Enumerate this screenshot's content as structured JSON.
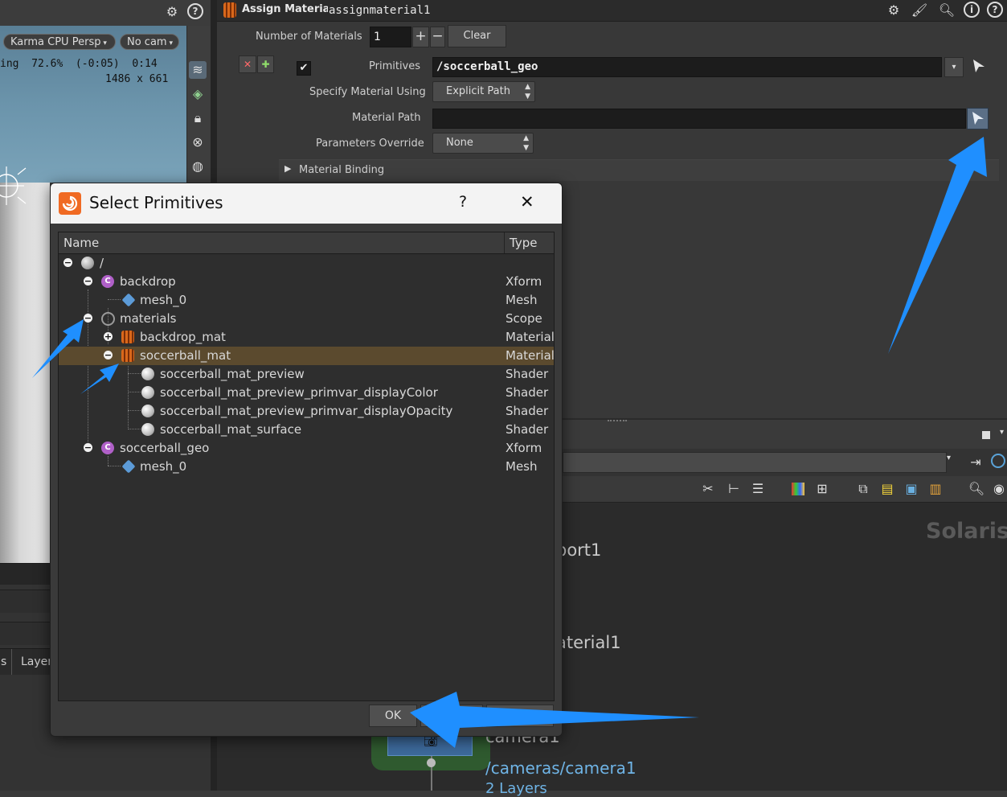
{
  "viewport": {
    "renderer_menu": "Karma CPU",
    "camera_menu": "Persp",
    "cam_menu": "No cam",
    "overlay_line1": "ing  72.6%  (-0:05)  0:14",
    "overlay_line2": "1486 x 661",
    "tab_partial_left": "s",
    "tab_layer": "Layer"
  },
  "params": {
    "node_type": "Assign Material",
    "node_name": "assignmaterial1",
    "num_materials_label": "Number of Materials",
    "num_materials_value": "1",
    "plus_label": "+",
    "minus_label": "−",
    "clear_label": "Clear",
    "primitives_label": "Primitives",
    "primitives_value": "/soccerball_geo",
    "specify_label": "Specify Material Using",
    "specify_value": "Explicit Path",
    "material_path_label": "Material Path",
    "material_path_value": "",
    "override_label": "Parameters Override",
    "override_value": "None",
    "binding_label": "Material Binding"
  },
  "network": {
    "context_label": "Solaris",
    "node_labels": [
      "port1",
      "aterial1",
      "camera1"
    ],
    "camera_path": "/cameras/camera1",
    "layers_partial": "2 Layers"
  },
  "dialog": {
    "title": "Select Primitives",
    "help_label": "?",
    "close_label": "✕",
    "col_name": "Name",
    "col_type": "Type",
    "rows": [
      {
        "name": "/",
        "type": ""
      },
      {
        "name": "backdrop",
        "type": "Xform"
      },
      {
        "name": "mesh_0",
        "type": "Mesh"
      },
      {
        "name": "materials",
        "type": "Scope"
      },
      {
        "name": "backdrop_mat",
        "type": "Material"
      },
      {
        "name": "soccerball_mat",
        "type": "Material"
      },
      {
        "name": "soccerball_mat_preview",
        "type": "Shader"
      },
      {
        "name": "soccerball_mat_preview_primvar_displayColor",
        "type": "Shader"
      },
      {
        "name": "soccerball_mat_preview_primvar_displayOpacity",
        "type": "Shader"
      },
      {
        "name": "soccerball_mat_surface",
        "type": "Shader"
      },
      {
        "name": "soccerball_geo",
        "type": "Xform"
      },
      {
        "name": "mesh_0",
        "type": "Mesh"
      }
    ],
    "ok_label": "OK"
  },
  "colors": {
    "accent_arrow": "#1f8fff",
    "selection_row": "#5b4a2e",
    "xform_icon": "#b060c8",
    "mesh_icon": "#5c9bd8",
    "material_icon": "#d9681b"
  }
}
